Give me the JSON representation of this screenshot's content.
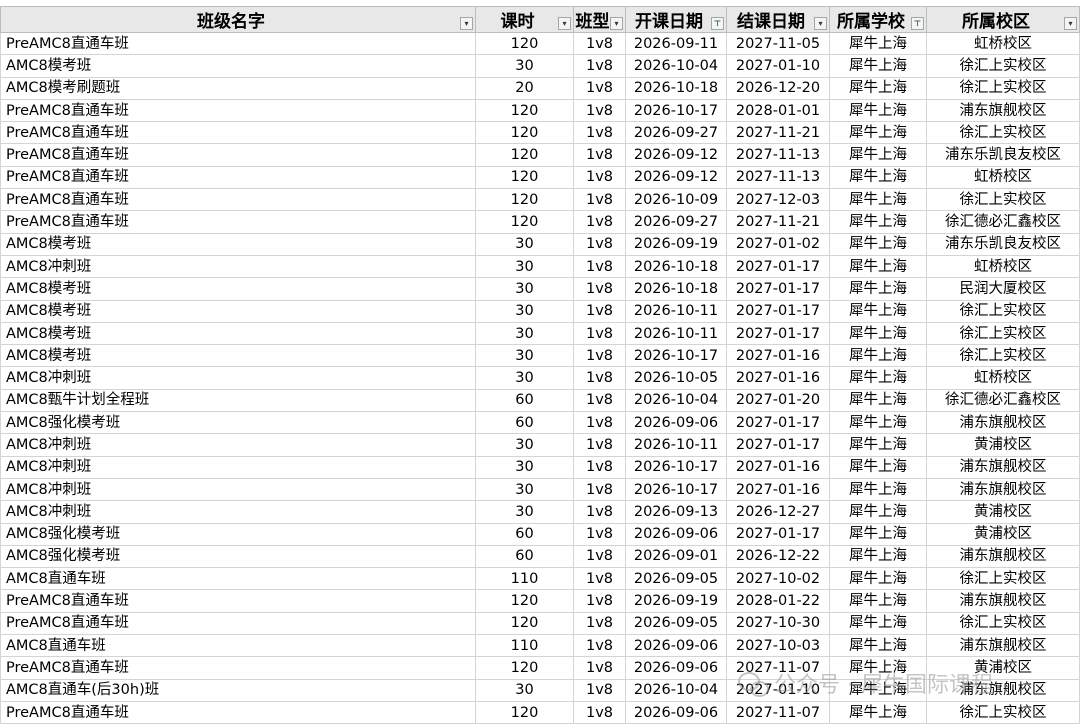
{
  "headers": [
    "班级名字",
    "课时",
    "班型",
    "开课日期",
    "结课日期",
    "所属学校",
    "所属校区"
  ],
  "filter_icons": [
    "dropdown-icon",
    "dropdown-icon",
    "dropdown-icon",
    "filter-active-icon",
    "dropdown-icon",
    "filter-active-icon",
    "dropdown-icon"
  ],
  "rows": [
    [
      "PreAMC8直通车班",
      "120",
      "1v8",
      "2026-09-11",
      "2027-11-05",
      "犀牛上海",
      "虹桥校区"
    ],
    [
      "AMC8模考班",
      "30",
      "1v8",
      "2026-10-04",
      "2027-01-10",
      "犀牛上海",
      "徐汇上实校区"
    ],
    [
      "AMC8模考刷题班",
      "20",
      "1v8",
      "2026-10-18",
      "2026-12-20",
      "犀牛上海",
      "徐汇上实校区"
    ],
    [
      "PreAMC8直通车班",
      "120",
      "1v8",
      "2026-10-17",
      "2028-01-01",
      "犀牛上海",
      "浦东旗舰校区"
    ],
    [
      "PreAMC8直通车班",
      "120",
      "1v8",
      "2026-09-27",
      "2027-11-21",
      "犀牛上海",
      "徐汇上实校区"
    ],
    [
      "PreAMC8直通车班",
      "120",
      "1v8",
      "2026-09-12",
      "2027-11-13",
      "犀牛上海",
      "浦东乐凯良友校区"
    ],
    [
      "PreAMC8直通车班",
      "120",
      "1v8",
      "2026-09-12",
      "2027-11-13",
      "犀牛上海",
      "虹桥校区"
    ],
    [
      "PreAMC8直通车班",
      "120",
      "1v8",
      "2026-10-09",
      "2027-12-03",
      "犀牛上海",
      "徐汇上实校区"
    ],
    [
      "PreAMC8直通车班",
      "120",
      "1v8",
      "2026-09-27",
      "2027-11-21",
      "犀牛上海",
      "徐汇德必汇鑫校区"
    ],
    [
      "AMC8模考班",
      "30",
      "1v8",
      "2026-09-19",
      "2027-01-02",
      "犀牛上海",
      "浦东乐凯良友校区"
    ],
    [
      "AMC8冲刺班",
      "30",
      "1v8",
      "2026-10-18",
      "2027-01-17",
      "犀牛上海",
      "虹桥校区"
    ],
    [
      "AMC8模考班",
      "30",
      "1v8",
      "2026-10-18",
      "2027-01-17",
      "犀牛上海",
      "民润大厦校区"
    ],
    [
      "AMC8模考班",
      "30",
      "1v8",
      "2026-10-11",
      "2027-01-17",
      "犀牛上海",
      "徐汇上实校区"
    ],
    [
      "AMC8模考班",
      "30",
      "1v8",
      "2026-10-11",
      "2027-01-17",
      "犀牛上海",
      "徐汇上实校区"
    ],
    [
      "AMC8模考班",
      "30",
      "1v8",
      "2026-10-17",
      "2027-01-16",
      "犀牛上海",
      "徐汇上实校区"
    ],
    [
      "AMC8冲刺班",
      "30",
      "1v8",
      "2026-10-05",
      "2027-01-16",
      "犀牛上海",
      "虹桥校区"
    ],
    [
      "AMC8甄牛计划全程班",
      "60",
      "1v8",
      "2026-10-04",
      "2027-01-20",
      "犀牛上海",
      "徐汇德必汇鑫校区"
    ],
    [
      "AMC8强化模考班",
      "60",
      "1v8",
      "2026-09-06",
      "2027-01-17",
      "犀牛上海",
      "浦东旗舰校区"
    ],
    [
      "AMC8冲刺班",
      "30",
      "1v8",
      "2026-10-11",
      "2027-01-17",
      "犀牛上海",
      "黄浦校区"
    ],
    [
      "AMC8冲刺班",
      "30",
      "1v8",
      "2026-10-17",
      "2027-01-16",
      "犀牛上海",
      "浦东旗舰校区"
    ],
    [
      "AMC8冲刺班",
      "30",
      "1v8",
      "2026-10-17",
      "2027-01-16",
      "犀牛上海",
      "浦东旗舰校区"
    ],
    [
      "AMC8冲刺班",
      "30",
      "1v8",
      "2026-09-13",
      "2026-12-27",
      "犀牛上海",
      "黄浦校区"
    ],
    [
      "AMC8强化模考班",
      "60",
      "1v8",
      "2026-09-06",
      "2027-01-17",
      "犀牛上海",
      "黄浦校区"
    ],
    [
      "AMC8强化模考班",
      "60",
      "1v8",
      "2026-09-01",
      "2026-12-22",
      "犀牛上海",
      "浦东旗舰校区"
    ],
    [
      "AMC8直通车班",
      "110",
      "1v8",
      "2026-09-05",
      "2027-10-02",
      "犀牛上海",
      "徐汇上实校区"
    ],
    [
      "PreAMC8直通车班",
      "120",
      "1v8",
      "2026-09-19",
      "2028-01-22",
      "犀牛上海",
      "浦东旗舰校区"
    ],
    [
      "PreAMC8直通车班",
      "120",
      "1v8",
      "2026-09-05",
      "2027-10-30",
      "犀牛上海",
      "徐汇上实校区"
    ],
    [
      "AMC8直通车班",
      "110",
      "1v8",
      "2026-09-06",
      "2027-10-03",
      "犀牛上海",
      "浦东旗舰校区"
    ],
    [
      "PreAMC8直通车班",
      "120",
      "1v8",
      "2026-09-06",
      "2027-11-07",
      "犀牛上海",
      "黄浦校区"
    ],
    [
      "AMC8直通车(后30h)班",
      "30",
      "1v8",
      "2026-10-04",
      "2027-01-10",
      "犀牛上海",
      "浦东旗舰校区"
    ],
    [
      "PreAMC8直通车班",
      "120",
      "1v8",
      "2026-09-06",
      "2027-11-07",
      "犀牛上海",
      "徐汇上实校区"
    ]
  ],
  "watermark": "公众号 · 犀牛国际课程",
  "colors": {
    "header_bg": "#e8e8e8",
    "grid": "#d4d4d4",
    "filter_active": "#1b6f3b"
  }
}
